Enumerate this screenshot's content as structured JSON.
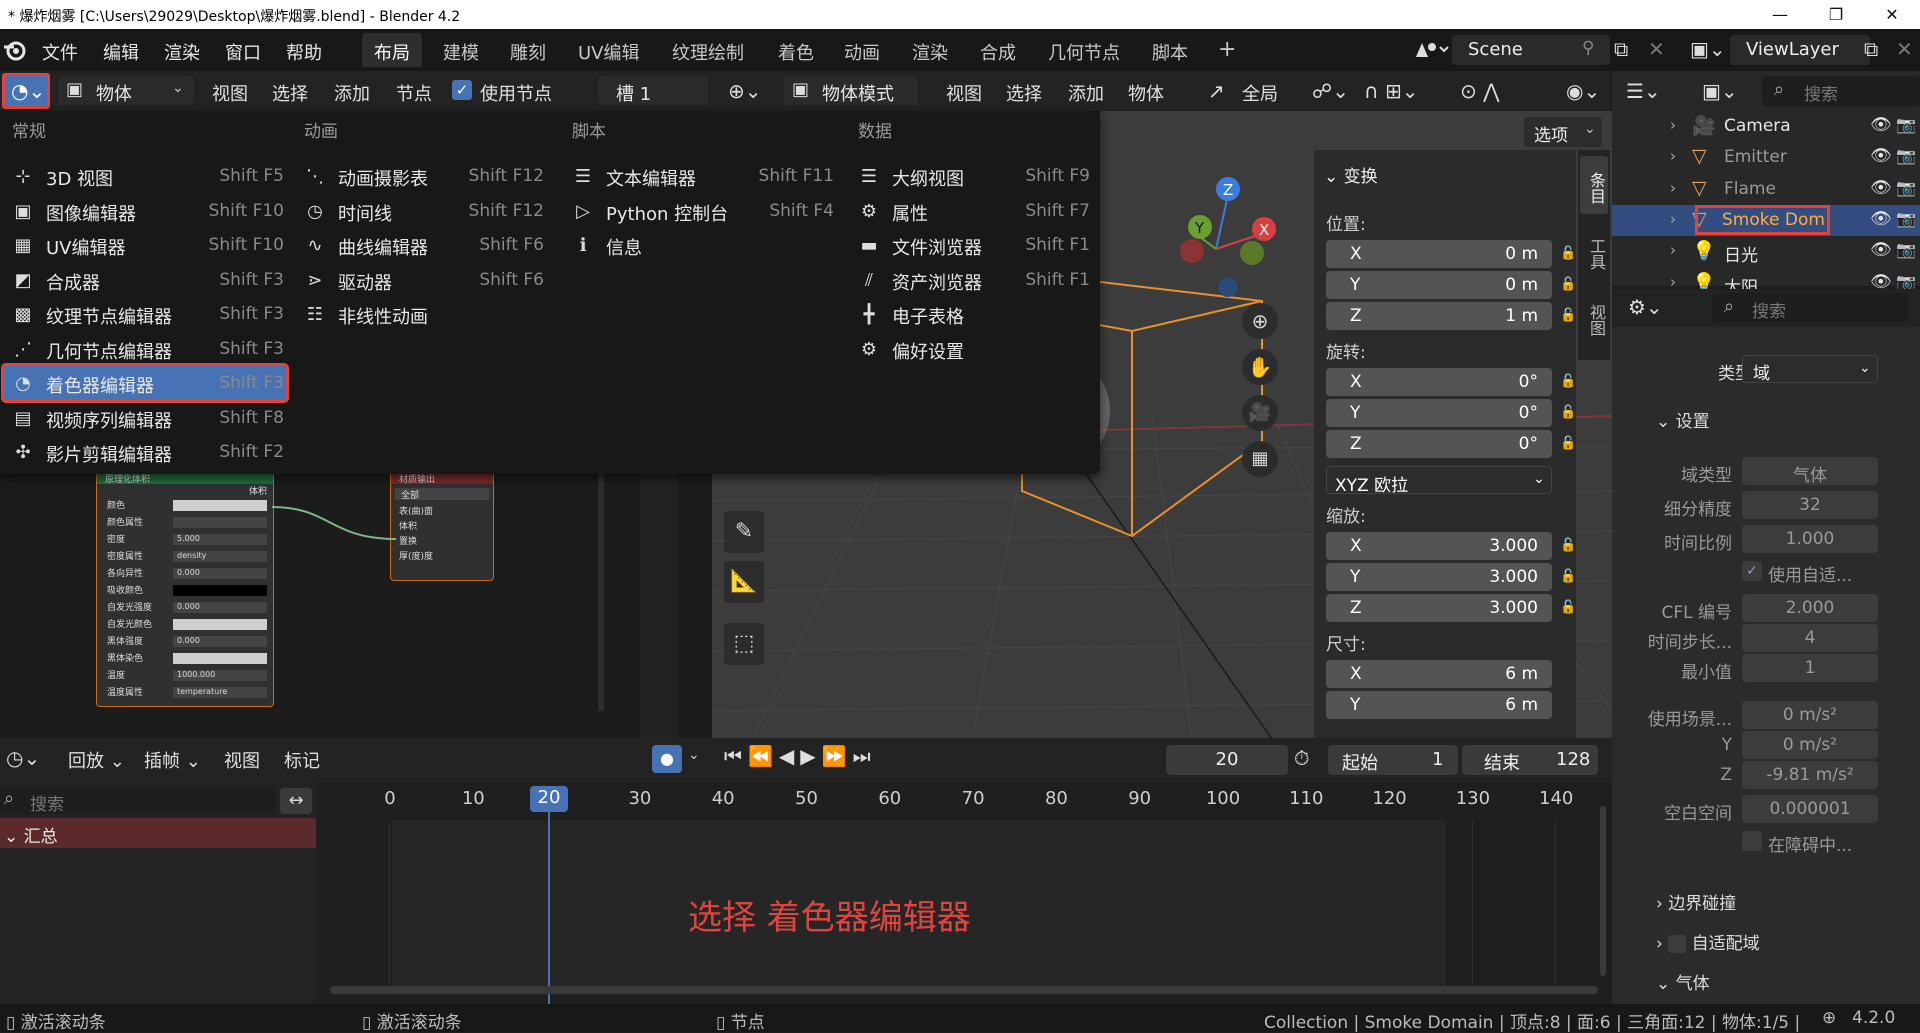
{
  "window": {
    "title": "* 爆炸烟雾 [C:\\Users\\29029\\Desktop\\爆炸烟雾.blend] - Blender 4.2",
    "controls": [
      "—",
      "❐",
      "✕"
    ]
  },
  "menubar": {
    "items": [
      "文件",
      "编辑",
      "渲染",
      "窗口",
      "帮助"
    ],
    "workspaces": [
      "布局",
      "建模",
      "雕刻",
      "UV编辑",
      "纹理绘制",
      "着色",
      "动画",
      "渲染",
      "合成",
      "几何节点",
      "脚本"
    ],
    "active_workspace": "布局",
    "add_tab": "+",
    "scene": "Scene",
    "viewlayer": "ViewLayer"
  },
  "node_header": {
    "object_select": "物体",
    "menus": [
      "视图",
      "选择",
      "添加",
      "节点"
    ],
    "use_nodes": "使用节点",
    "slot": "槽 1"
  },
  "viewport_header": {
    "mode": "物体模式",
    "menus": [
      "视图",
      "选择",
      "添加",
      "物体"
    ],
    "transform_orientation": "全局",
    "options": "选项"
  },
  "editor_menu": {
    "columns": [
      {
        "header": "常规",
        "items": [
          {
            "icon": "3d-view-icon",
            "label": "3D 视图",
            "shortcut": "Shift F5"
          },
          {
            "icon": "image-editor-icon",
            "label": "图像编辑器",
            "shortcut": "Shift F10"
          },
          {
            "icon": "uv-editor-icon",
            "label": "UV编辑器",
            "shortcut": "Shift F10"
          },
          {
            "icon": "compositor-icon",
            "label": "合成器",
            "shortcut": "Shift F3"
          },
          {
            "icon": "texture-node-icon",
            "label": "纹理节点编辑器",
            "shortcut": "Shift F3"
          },
          {
            "icon": "geometry-node-icon",
            "label": "几何节点编辑器",
            "shortcut": "Shift F3"
          },
          {
            "icon": "shader-editor-icon",
            "label": "着色器编辑器",
            "shortcut": "Shift F3"
          },
          {
            "icon": "sequencer-icon",
            "label": "视频序列编辑器",
            "shortcut": "Shift F8"
          },
          {
            "icon": "clip-editor-icon",
            "label": "影片剪辑编辑器",
            "shortcut": "Shift F2"
          }
        ]
      },
      {
        "header": "动画",
        "items": [
          {
            "icon": "dopesheet-icon",
            "label": "动画摄影表",
            "shortcut": "Shift F12"
          },
          {
            "icon": "timeline-icon",
            "label": "时间线",
            "shortcut": "Shift F12"
          },
          {
            "icon": "graph-editor-icon",
            "label": "曲线编辑器",
            "shortcut": "Shift F6"
          },
          {
            "icon": "drivers-icon",
            "label": "驱动器",
            "shortcut": "Shift F6"
          },
          {
            "icon": "nla-icon",
            "label": "非线性动画",
            "shortcut": ""
          }
        ]
      },
      {
        "header": "脚本",
        "items": [
          {
            "icon": "text-editor-icon",
            "label": "文本编辑器",
            "shortcut": "Shift F11"
          },
          {
            "icon": "python-console-icon",
            "label": "Python 控制台",
            "shortcut": "Shift F4"
          },
          {
            "icon": "info-icon",
            "label": "信息",
            "shortcut": ""
          }
        ]
      },
      {
        "header": "数据",
        "items": [
          {
            "icon": "outliner-icon",
            "label": "大纲视图",
            "shortcut": "Shift F9"
          },
          {
            "icon": "properties-icon",
            "label": "属性",
            "shortcut": "Shift F7"
          },
          {
            "icon": "file-browser-icon",
            "label": "文件浏览器",
            "shortcut": "Shift F1"
          },
          {
            "icon": "asset-browser-icon",
            "label": "资产浏览器",
            "shortcut": "Shift F1"
          },
          {
            "icon": "spreadsheet-icon",
            "label": "电子表格",
            "shortcut": ""
          },
          {
            "icon": "preferences-icon",
            "label": "偏好设置",
            "shortcut": ""
          }
        ]
      }
    ],
    "highlighted": "着色器编辑器"
  },
  "nodes": {
    "volume": {
      "title": "原理化体积",
      "output": "体积",
      "rows": [
        {
          "label": "颜色",
          "value": ""
        },
        {
          "label": "颜色属性",
          "value": ""
        },
        {
          "label": "密度",
          "value": "5.000"
        },
        {
          "label": "密度属性",
          "value": "density"
        },
        {
          "label": "各向异性",
          "value": "0.000"
        },
        {
          "label": "吸收颜色",
          "value": ""
        },
        {
          "label": "自发光强度",
          "value": "0.000"
        },
        {
          "label": "自发光颜色",
          "value": ""
        },
        {
          "label": "黑体强度",
          "value": "0.000"
        },
        {
          "label": "黑体染色",
          "value": ""
        },
        {
          "label": "温度",
          "value": "1000.000"
        },
        {
          "label": "温度属性",
          "value": "temperature"
        }
      ]
    },
    "output": {
      "title": "材质输出",
      "target": "全部",
      "rows": [
        "表(曲)面",
        "体积",
        "置换",
        "厚(度)度"
      ]
    }
  },
  "npanel": {
    "tabs": [
      "条目",
      "工具",
      "视图"
    ],
    "section": "变换",
    "location_label": "位置:",
    "location": [
      {
        "axis": "X",
        "value": "0 m"
      },
      {
        "axis": "Y",
        "value": "0 m"
      },
      {
        "axis": "Z",
        "value": "1 m"
      }
    ],
    "rotation_label": "旋转:",
    "rotation": [
      {
        "axis": "X",
        "value": "0°"
      },
      {
        "axis": "Y",
        "value": "0°"
      },
      {
        "axis": "Z",
        "value": "0°"
      }
    ],
    "rotation_mode": "XYZ 欧拉",
    "scale_label": "缩放:",
    "scale": [
      {
        "axis": "X",
        "value": "3.000"
      },
      {
        "axis": "Y",
        "value": "3.000"
      },
      {
        "axis": "Z",
        "value": "3.000"
      }
    ],
    "dimensions_label": "尺寸:",
    "dimensions": [
      {
        "axis": "X",
        "value": "6 m"
      },
      {
        "axis": "Y",
        "value": "6 m"
      }
    ]
  },
  "gizmo": {
    "x": "X",
    "y": "Y",
    "z": "Z"
  },
  "outliner": {
    "search_placeholder": "搜索",
    "items": [
      {
        "name": "Camera",
        "icon": "camera-icon",
        "color": "#e8a256"
      },
      {
        "name": "Emitter",
        "icon": "mesh-icon",
        "color": "#e8a256"
      },
      {
        "name": "Flame",
        "icon": "mesh-icon",
        "color": "#e8a256"
      },
      {
        "name": "Smoke Dom",
        "icon": "mesh-icon",
        "color": "#e8a256"
      },
      {
        "name": "日光",
        "icon": "light-icon",
        "color": "#e8a256"
      },
      {
        "name": "太阳",
        "icon": "light-icon",
        "color": "#e8a256"
      }
    ]
  },
  "properties": {
    "search_placeholder": "搜索",
    "type_label": "类型",
    "type_value": "域",
    "settings": "设置",
    "rows": [
      {
        "label": "域类型",
        "value": "气体"
      },
      {
        "label": "细分精度",
        "value": "32"
      },
      {
        "label": "时间比例",
        "value": "1.000"
      },
      {
        "label": "",
        "value": "使用自适..."
      },
      {
        "label": "CFL 编号",
        "value": "2.000"
      },
      {
        "label": "时间步长...",
        "value": "4"
      },
      {
        "label": "最小值",
        "value": "1"
      },
      {
        "label": "使用场景...",
        "value": "0 m/s²"
      },
      {
        "label": "Y",
        "value": "0 m/s²"
      },
      {
        "label": "Z",
        "value": "-9.81 m/s²"
      },
      {
        "label": "空白空间",
        "value": "0.000001"
      },
      {
        "label": "",
        "value": "在障碍中..."
      }
    ],
    "boundary": "边界碰撞",
    "adaptive": "自适配域",
    "gas": "气体"
  },
  "timeline": {
    "menus": [
      "回放",
      "插帧",
      "视图",
      "标记"
    ],
    "current_frame": "20",
    "start_label": "起始",
    "start": "1",
    "end_label": "结束",
    "end": "128",
    "search_placeholder": "搜索",
    "summary": "汇总",
    "ticks": [
      "0",
      "10",
      "20",
      "30",
      "40",
      "50",
      "60",
      "70",
      "80",
      "90",
      "100",
      "110",
      "120",
      "130",
      "140"
    ]
  },
  "annotation": "选择 着色器编辑器",
  "statusbar": {
    "left": "激活滚动条",
    "mid": "激活滚动条",
    "right": "节点",
    "info": "Collection | Smoke Domain | 顶点:8 | 面:6 | 三角面:12 | 物体:1/5 |",
    "version": "4.2.0"
  },
  "colors": {
    "highlight": "#4772b3",
    "annotation": "#e0443e",
    "selected_row": "#334d80"
  }
}
